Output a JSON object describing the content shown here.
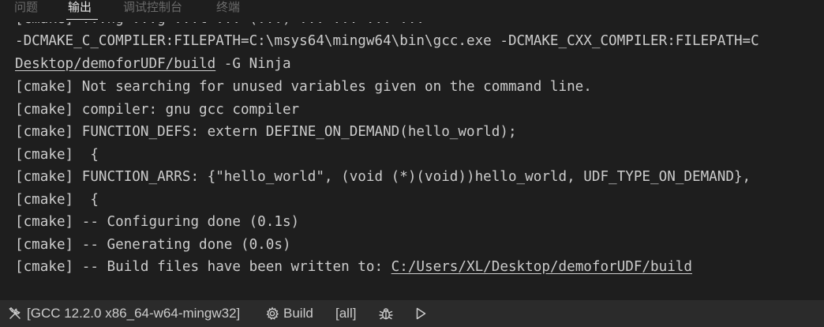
{
  "tabs": [
    {
      "label": "问题",
      "active": false
    },
    {
      "label": "输出",
      "active": true
    },
    {
      "label": "调试控制台",
      "active": false
    },
    {
      "label": "终端",
      "active": false
    }
  ],
  "output": {
    "partial_top": "[cmake] ...ng ...g ...t ... (...) ... ... ... ...",
    "lines": [
      {
        "text": "-DCMAKE_C_COMPILER:FILEPATH=C:\\msys64\\mingw64\\bin\\gcc.exe -DCMAKE_CXX_COMPILER:FILEPATH=C"
      },
      {
        "link": "Desktop/demoforUDF/build",
        "rest": " -G Ninja"
      },
      {
        "text": "[cmake] Not searching for unused variables given on the command line."
      },
      {
        "text": "[cmake] compiler: gnu gcc compiler"
      },
      {
        "text": "[cmake] FUNCTION_DEFS: extern DEFINE_ON_DEMAND(hello_world);"
      },
      {
        "text": "[cmake]  {"
      },
      {
        "text": "[cmake] FUNCTION_ARRS: {\"hello_world\", (void (*)(void))hello_world, UDF_TYPE_ON_DEMAND},"
      },
      {
        "text": "[cmake]  {"
      },
      {
        "text": "[cmake] -- Configuring done (0.1s)"
      },
      {
        "text": "[cmake] -- Generating done (0.0s)"
      },
      {
        "prefix": "[cmake] -- Build files have been written to: ",
        "link": "C:/Users/XL/Desktop/demoforUDF/build"
      }
    ]
  },
  "statusbar": {
    "kit_icon": "tools-icon",
    "kit_label": "[GCC 12.2.0 x86_64-w64-mingw32]",
    "build_icon": "gear-icon",
    "build_label": "Build",
    "target_label": "[all]",
    "debug_icon": "bug-icon",
    "run_icon": "play-icon"
  }
}
